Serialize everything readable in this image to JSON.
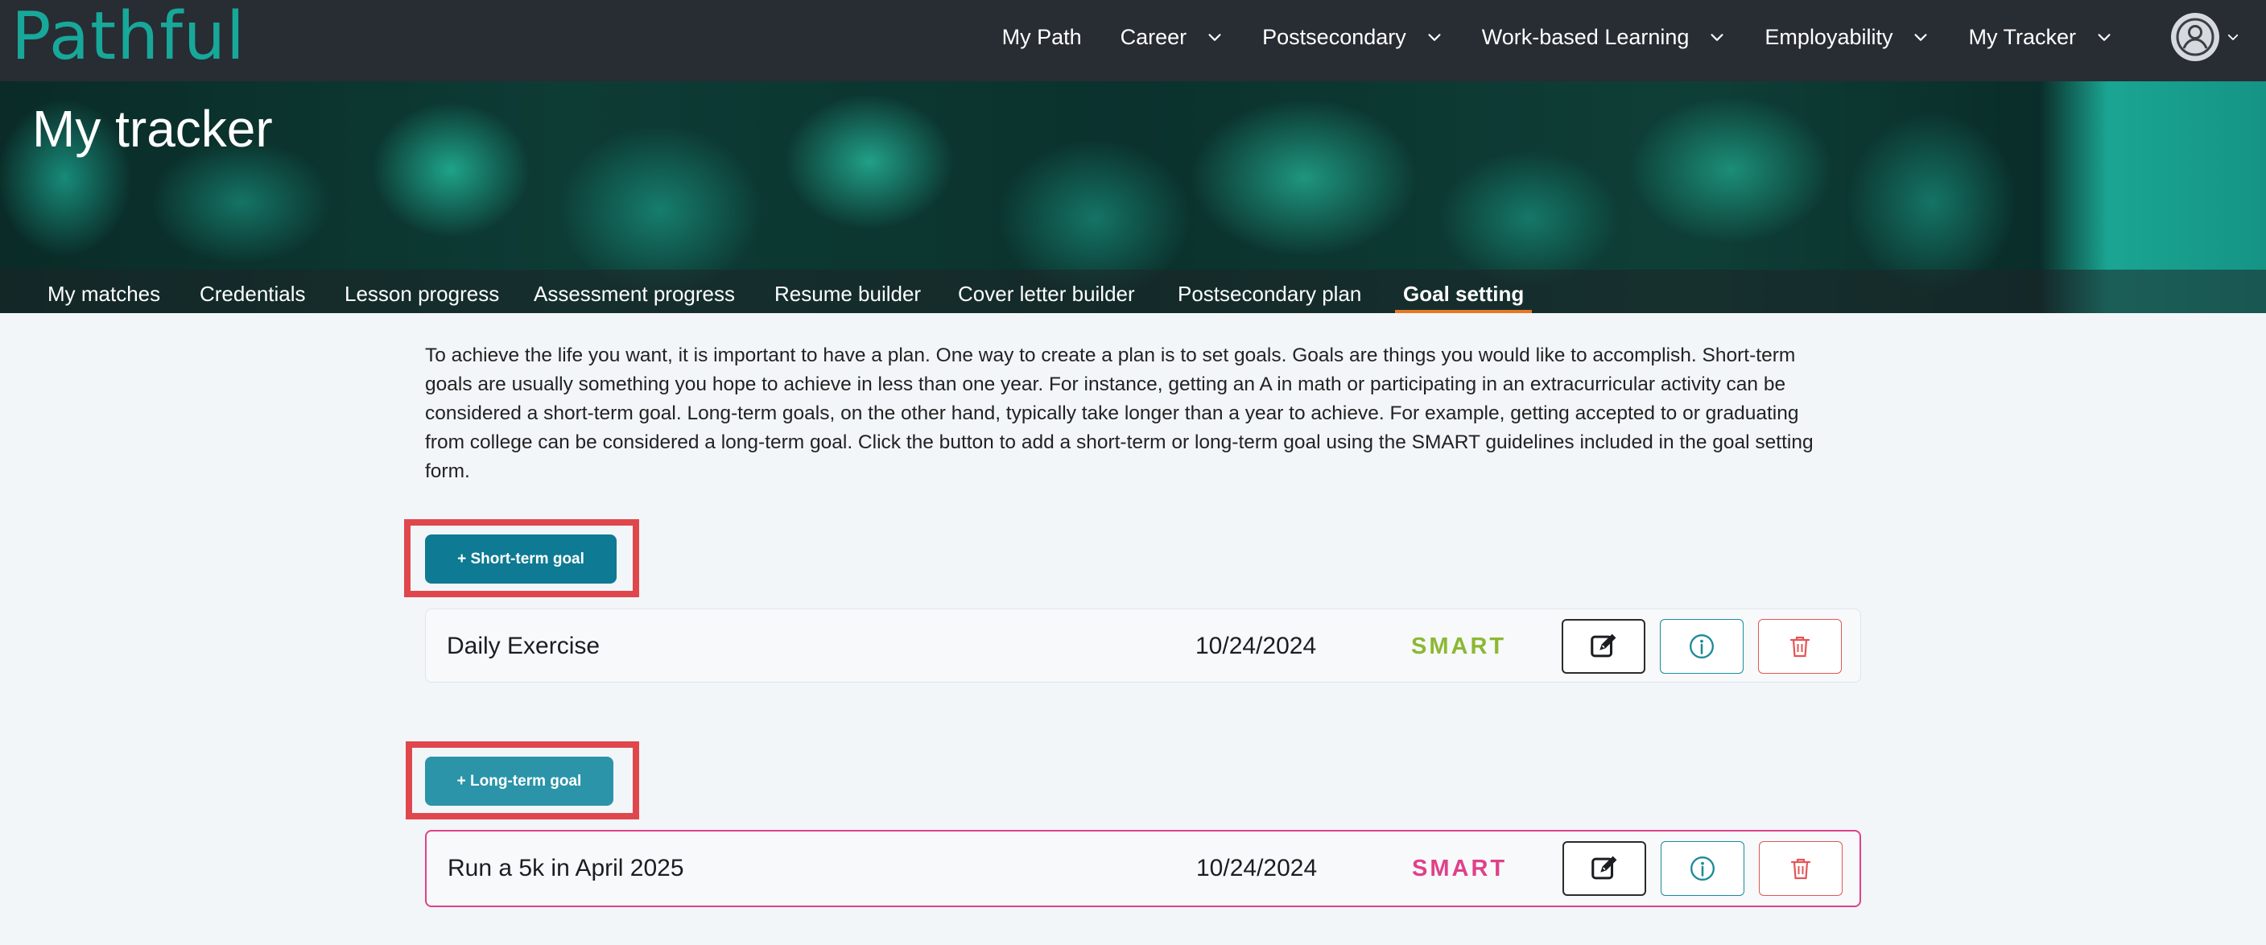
{
  "brand": {
    "logo_text": "Pathful",
    "color": "#17a89a"
  },
  "nav": {
    "items": [
      {
        "label": "My Path",
        "has_dropdown": false
      },
      {
        "label": "Career",
        "has_dropdown": true
      },
      {
        "label": "Postsecondary",
        "has_dropdown": true
      },
      {
        "label": "Work-based Learning",
        "has_dropdown": true
      },
      {
        "label": "Employability",
        "has_dropdown": true
      },
      {
        "label": "My Tracker",
        "has_dropdown": true
      }
    ],
    "avatar_icon": "user-circle-icon"
  },
  "hero": {
    "title": "My tracker"
  },
  "subnav": {
    "tabs": [
      {
        "label": "My matches"
      },
      {
        "label": "Credentials"
      },
      {
        "label": "Lesson progress"
      },
      {
        "label": "Assessment progress"
      },
      {
        "label": "Resume builder"
      },
      {
        "label": "Cover letter builder"
      },
      {
        "label": "Postsecondary plan"
      },
      {
        "label": "Goal setting",
        "active": true
      }
    ],
    "active_color": "#e87722"
  },
  "intro": {
    "text": "To achieve the life you want, it is important to have a plan. One way to create a plan is to set goals. Goals are things you would like to accomplish. Short-term goals are usually something you hope to achieve in less than one year. For instance, getting an A in math or participating in an extracurricular activity can be considered a short-term goal. Long-term goals, on the other hand, typically take longer than a year to achieve. For example, getting accepted to or graduating from college can be considered a long-term goal. Click the button to add a short-term or long-term goal using the SMART guidelines included in the goal setting form."
  },
  "short_term": {
    "add_label": "+ Short-term goal",
    "button_color": "#0e7a93",
    "goals": [
      {
        "name": "Daily Exercise",
        "date": "10/24/2024",
        "badge": "SMART",
        "badge_color": "#8cb833"
      }
    ]
  },
  "long_term": {
    "add_label": "+ Long-term goal",
    "button_color": "#2b94a9",
    "goals": [
      {
        "name": "Run a 5k in April 2025",
        "date": "10/24/2024",
        "badge": "SMART",
        "badge_color": "#e0408a"
      }
    ]
  },
  "actions": {
    "edit_icon": "edit-icon",
    "info_icon": "info-icon",
    "delete_icon": "trash-icon"
  },
  "highlight_color": "#e0474c"
}
